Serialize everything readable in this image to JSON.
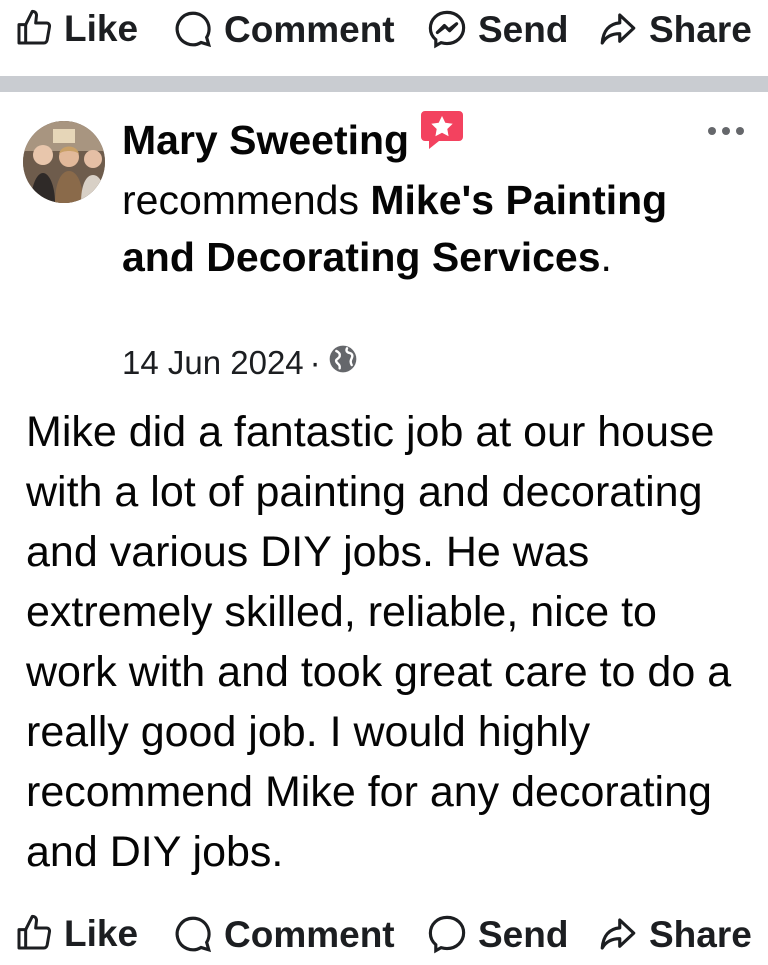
{
  "action_bar": {
    "like_label": "Like",
    "comment_label": "Comment",
    "send_label": "Send",
    "share_label": "Share"
  },
  "post": {
    "author": "Mary Sweeting",
    "verb": "recommends",
    "business": "Mike's Painting and Decorating Services",
    "period": ".",
    "date": "14 Jun 2024",
    "separator": "·",
    "body": "Mike did a fantastic job at our house with a lot of painting and decorating and various DIY jobs. He was extremely skilled, reliable, nice to work with and took great care to do a really good job. I would highly recommend Mike for any decorating and DIY jobs."
  },
  "icons": {
    "like": "thumbs-up-icon",
    "comment": "comment-bubble-icon",
    "send": "messenger-icon",
    "share": "share-arrow-icon",
    "recommend_badge": "recommend-star-icon",
    "audience": "globe-icon",
    "more": "more-options-icon"
  },
  "colors": {
    "divider": "#c9ccd1",
    "badge": "#f3425f",
    "text_primary": "#050505",
    "icon": "#1c1e21"
  }
}
